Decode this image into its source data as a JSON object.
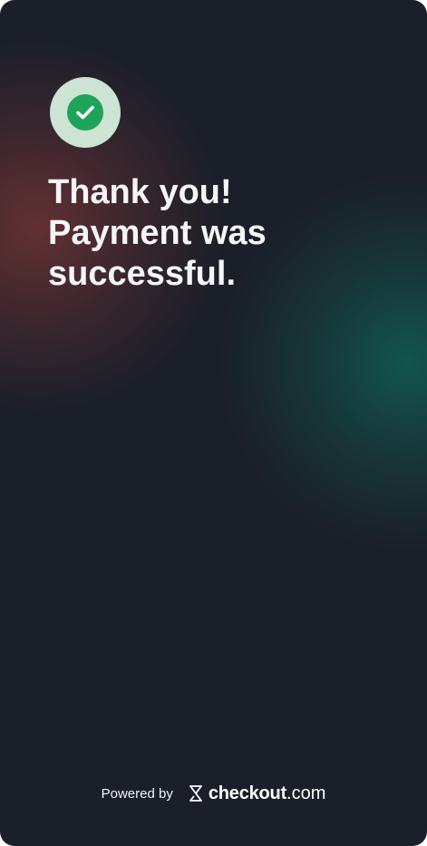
{
  "status": {
    "icon": "check-icon",
    "badge_bg": "#cde3d3",
    "check_color": "#1fa35a"
  },
  "message": {
    "line1": "Thank you!",
    "line2": "Payment was",
    "line3": "successful."
  },
  "footer": {
    "powered_by": "Powered by",
    "brand_name": "checkout",
    "brand_tld": ".com",
    "brand_icon": "checkout-logo-icon"
  },
  "colors": {
    "background": "#1b1f29",
    "accent_teal": "#125850",
    "accent_red": "#6e3434"
  }
}
